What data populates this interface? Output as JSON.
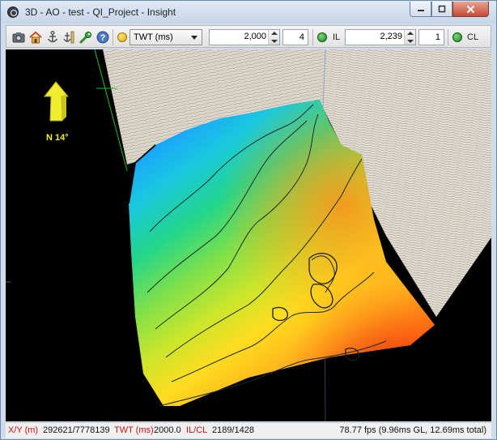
{
  "window": {
    "title": "3D - AO - test - QI_Project - Insight",
    "minimize_icon": "minimize-icon",
    "maximize_icon": "maximize-icon",
    "close_icon": "close-icon"
  },
  "toolbar": {
    "tools": [
      {
        "name": "camera-icon"
      },
      {
        "name": "home-icon"
      },
      {
        "name": "anchor-icon"
      },
      {
        "name": "ruler-anchor-icon"
      },
      {
        "name": "wrench-icon"
      },
      {
        "name": "help-icon"
      }
    ],
    "domain_select": {
      "value": "TWT (ms)"
    },
    "twt_value": "2,000",
    "twt_step": "4",
    "il_label": "IL",
    "il_value": "2,239",
    "il_step": "1",
    "cl_label": "CL",
    "status_colors": {
      "twt": "#e0a800",
      "il": "#1b8a1b",
      "cl": "#1b8a1b"
    }
  },
  "viewport": {
    "north_label": "N 14°",
    "background": "#000000"
  },
  "statusbar": {
    "xy_label": "X/Y (m)",
    "xy_value": "292621/7778139",
    "twt_label": "TWT (ms)",
    "twt_value": "2000.0",
    "ilcl_label": "IL/CL",
    "ilcl_value": "2189/1428",
    "fps": "78.77 fps (9.96ms GL, 12.69ms total)"
  }
}
